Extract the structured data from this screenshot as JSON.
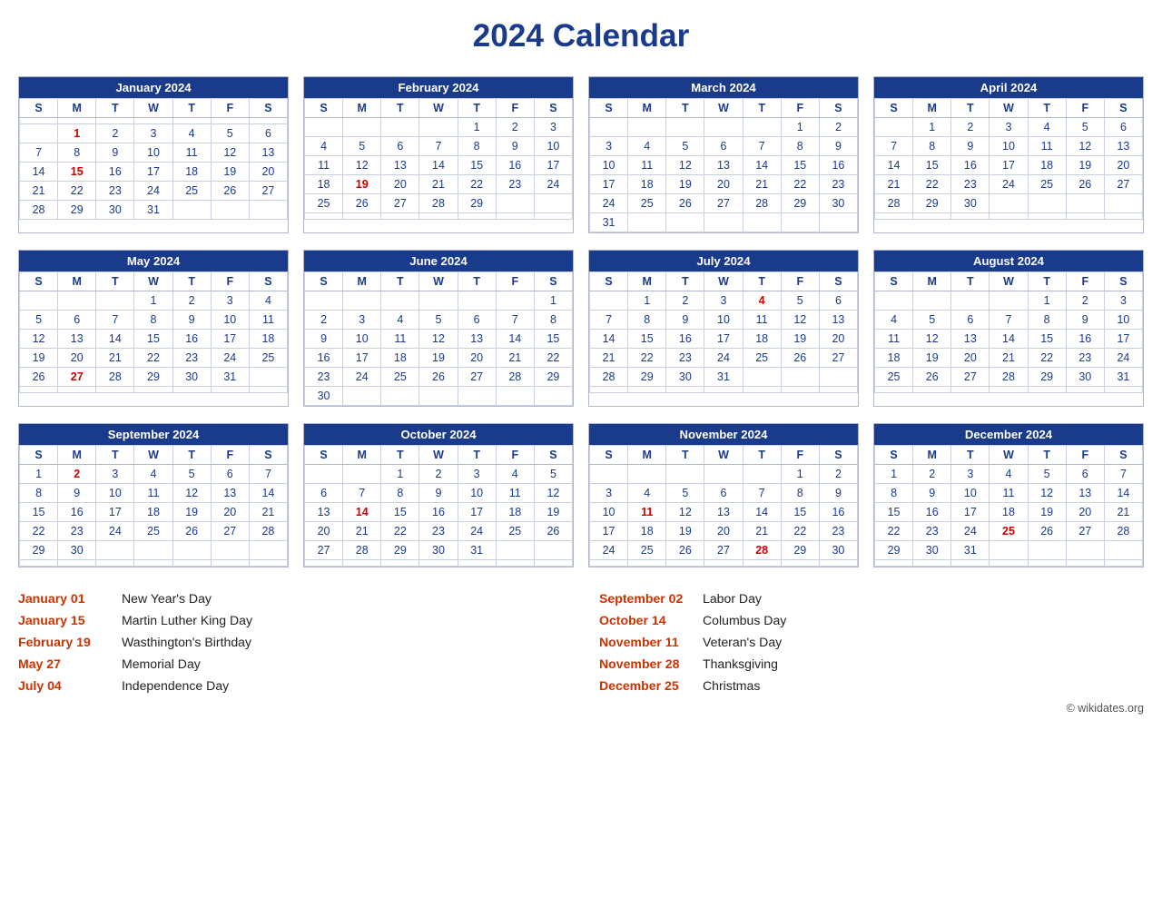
{
  "title": "2024 Calendar",
  "months": [
    {
      "name": "January 2024",
      "days": [
        [
          "",
          "",
          "",
          "",
          "",
          "",
          ""
        ],
        [
          "",
          "1",
          "2",
          "3",
          "4",
          "5",
          "6"
        ],
        [
          "7",
          "8",
          "9",
          "10",
          "11",
          "12",
          "13"
        ],
        [
          "14",
          "15",
          "16",
          "17",
          "18",
          "19",
          "20"
        ],
        [
          "21",
          "22",
          "23",
          "24",
          "25",
          "26",
          "27"
        ],
        [
          "28",
          "29",
          "30",
          "31",
          "",
          "",
          ""
        ]
      ],
      "holidays": [
        "1",
        "15"
      ]
    },
    {
      "name": "February 2024",
      "days": [
        [
          "",
          "",
          "",
          "",
          "1",
          "2",
          "3"
        ],
        [
          "4",
          "5",
          "6",
          "7",
          "8",
          "9",
          "10"
        ],
        [
          "11",
          "12",
          "13",
          "14",
          "15",
          "16",
          "17"
        ],
        [
          "18",
          "19",
          "20",
          "21",
          "22",
          "23",
          "24"
        ],
        [
          "25",
          "26",
          "27",
          "28",
          "29",
          "",
          ""
        ],
        [
          "",
          "",
          "",
          "",
          "",
          "",
          ""
        ]
      ],
      "holidays": [
        "19"
      ]
    },
    {
      "name": "March 2024",
      "days": [
        [
          "",
          "",
          "",
          "",
          "",
          "1",
          "2"
        ],
        [
          "3",
          "4",
          "5",
          "6",
          "7",
          "8",
          "9"
        ],
        [
          "10",
          "11",
          "12",
          "13",
          "14",
          "15",
          "16"
        ],
        [
          "17",
          "18",
          "19",
          "20",
          "21",
          "22",
          "23"
        ],
        [
          "24",
          "25",
          "26",
          "27",
          "28",
          "29",
          "30"
        ],
        [
          "31",
          "",
          "",
          "",
          "",
          "",
          ""
        ]
      ],
      "holidays": []
    },
    {
      "name": "April 2024",
      "days": [
        [
          "",
          "1",
          "2",
          "3",
          "4",
          "5",
          "6"
        ],
        [
          "7",
          "8",
          "9",
          "10",
          "11",
          "12",
          "13"
        ],
        [
          "14",
          "15",
          "16",
          "17",
          "18",
          "19",
          "20"
        ],
        [
          "21",
          "22",
          "23",
          "24",
          "25",
          "26",
          "27"
        ],
        [
          "28",
          "29",
          "30",
          "",
          "",
          "",
          ""
        ],
        [
          "",
          "",
          "",
          "",
          "",
          "",
          ""
        ]
      ],
      "holidays": []
    },
    {
      "name": "May 2024",
      "days": [
        [
          "",
          "",
          "",
          "1",
          "2",
          "3",
          "4"
        ],
        [
          "5",
          "6",
          "7",
          "8",
          "9",
          "10",
          "11"
        ],
        [
          "12",
          "13",
          "14",
          "15",
          "16",
          "17",
          "18"
        ],
        [
          "19",
          "20",
          "21",
          "22",
          "23",
          "24",
          "25"
        ],
        [
          "26",
          "27",
          "28",
          "29",
          "30",
          "31",
          ""
        ],
        [
          "",
          "",
          "",
          "",
          "",
          "",
          ""
        ]
      ],
      "holidays": [
        "27"
      ]
    },
    {
      "name": "June 2024",
      "days": [
        [
          "",
          "",
          "",
          "",
          "",
          "",
          "1"
        ],
        [
          "2",
          "3",
          "4",
          "5",
          "6",
          "7",
          "8"
        ],
        [
          "9",
          "10",
          "11",
          "12",
          "13",
          "14",
          "15"
        ],
        [
          "16",
          "17",
          "18",
          "19",
          "20",
          "21",
          "22"
        ],
        [
          "23",
          "24",
          "25",
          "26",
          "27",
          "28",
          "29"
        ],
        [
          "30",
          "",
          "",
          "",
          "",
          "",
          ""
        ]
      ],
      "holidays": []
    },
    {
      "name": "July 2024",
      "days": [
        [
          "",
          "1",
          "2",
          "3",
          "4",
          "5",
          "6"
        ],
        [
          "7",
          "8",
          "9",
          "10",
          "11",
          "12",
          "13"
        ],
        [
          "14",
          "15",
          "16",
          "17",
          "18",
          "19",
          "20"
        ],
        [
          "21",
          "22",
          "23",
          "24",
          "25",
          "26",
          "27"
        ],
        [
          "28",
          "29",
          "30",
          "31",
          "",
          "",
          ""
        ],
        [
          "",
          "",
          "",
          "",
          "",
          "",
          ""
        ]
      ],
      "holidays": [
        "4"
      ]
    },
    {
      "name": "August 2024",
      "days": [
        [
          "",
          "",
          "",
          "",
          "1",
          "2",
          "3"
        ],
        [
          "4",
          "5",
          "6",
          "7",
          "8",
          "9",
          "10"
        ],
        [
          "11",
          "12",
          "13",
          "14",
          "15",
          "16",
          "17"
        ],
        [
          "18",
          "19",
          "20",
          "21",
          "22",
          "23",
          "24"
        ],
        [
          "25",
          "26",
          "27",
          "28",
          "29",
          "30",
          "31"
        ],
        [
          "",
          "",
          "",
          "",
          "",
          "",
          ""
        ]
      ],
      "holidays": []
    },
    {
      "name": "September 2024",
      "days": [
        [
          "1",
          "2",
          "3",
          "4",
          "5",
          "6",
          "7"
        ],
        [
          "8",
          "9",
          "10",
          "11",
          "12",
          "13",
          "14"
        ],
        [
          "15",
          "16",
          "17",
          "18",
          "19",
          "20",
          "21"
        ],
        [
          "22",
          "23",
          "24",
          "25",
          "26",
          "27",
          "28"
        ],
        [
          "29",
          "30",
          "",
          "",
          "",
          "",
          ""
        ],
        [
          "",
          "",
          "",
          "",
          "",
          "",
          ""
        ]
      ],
      "holidays": [
        "2"
      ]
    },
    {
      "name": "October 2024",
      "days": [
        [
          "",
          "",
          "1",
          "2",
          "3",
          "4",
          "5"
        ],
        [
          "6",
          "7",
          "8",
          "9",
          "10",
          "11",
          "12"
        ],
        [
          "13",
          "14",
          "15",
          "16",
          "17",
          "18",
          "19"
        ],
        [
          "20",
          "21",
          "22",
          "23",
          "24",
          "25",
          "26"
        ],
        [
          "27",
          "28",
          "29",
          "30",
          "31",
          "",
          ""
        ],
        [
          "",
          "",
          "",
          "",
          "",
          "",
          ""
        ]
      ],
      "holidays": [
        "14"
      ]
    },
    {
      "name": "November 2024",
      "days": [
        [
          "",
          "",
          "",
          "",
          "",
          "1",
          "2"
        ],
        [
          "3",
          "4",
          "5",
          "6",
          "7",
          "8",
          "9"
        ],
        [
          "10",
          "11",
          "12",
          "13",
          "14",
          "15",
          "16"
        ],
        [
          "17",
          "18",
          "19",
          "20",
          "21",
          "22",
          "23"
        ],
        [
          "24",
          "25",
          "26",
          "27",
          "28",
          "29",
          "30"
        ],
        [
          "",
          "",
          "",
          "",
          "",
          "",
          ""
        ]
      ],
      "holidays": [
        "11",
        "28"
      ]
    },
    {
      "name": "December 2024",
      "days": [
        [
          "1",
          "2",
          "3",
          "4",
          "5",
          "6",
          "7"
        ],
        [
          "8",
          "9",
          "10",
          "11",
          "12",
          "13",
          "14"
        ],
        [
          "15",
          "16",
          "17",
          "18",
          "19",
          "20",
          "21"
        ],
        [
          "22",
          "23",
          "24",
          "25",
          "26",
          "27",
          "28"
        ],
        [
          "29",
          "30",
          "31",
          "",
          "",
          "",
          ""
        ],
        [
          "",
          "",
          "",
          "",
          "",
          "",
          ""
        ]
      ],
      "holidays": [
        "25"
      ]
    }
  ],
  "day_headers": [
    "S",
    "M",
    "T",
    "W",
    "T",
    "F",
    "S"
  ],
  "holidays_list": [
    {
      "date": "January 01",
      "name": "New Year's Day"
    },
    {
      "date": "January 15",
      "name": "Martin Luther King Day"
    },
    {
      "date": "February 19",
      "name": "Wasthington's Birthday"
    },
    {
      "date": "May 27",
      "name": "Memorial Day"
    },
    {
      "date": "July 04",
      "name": "Independence Day"
    },
    {
      "date": "September 02",
      "name": "Labor Day"
    },
    {
      "date": "October 14",
      "name": "Columbus Day"
    },
    {
      "date": "November 11",
      "name": "Veteran's Day"
    },
    {
      "date": "November 28",
      "name": "Thanksgiving"
    },
    {
      "date": "December 25",
      "name": "Christmas"
    }
  ],
  "footer": "© wikidates.org"
}
